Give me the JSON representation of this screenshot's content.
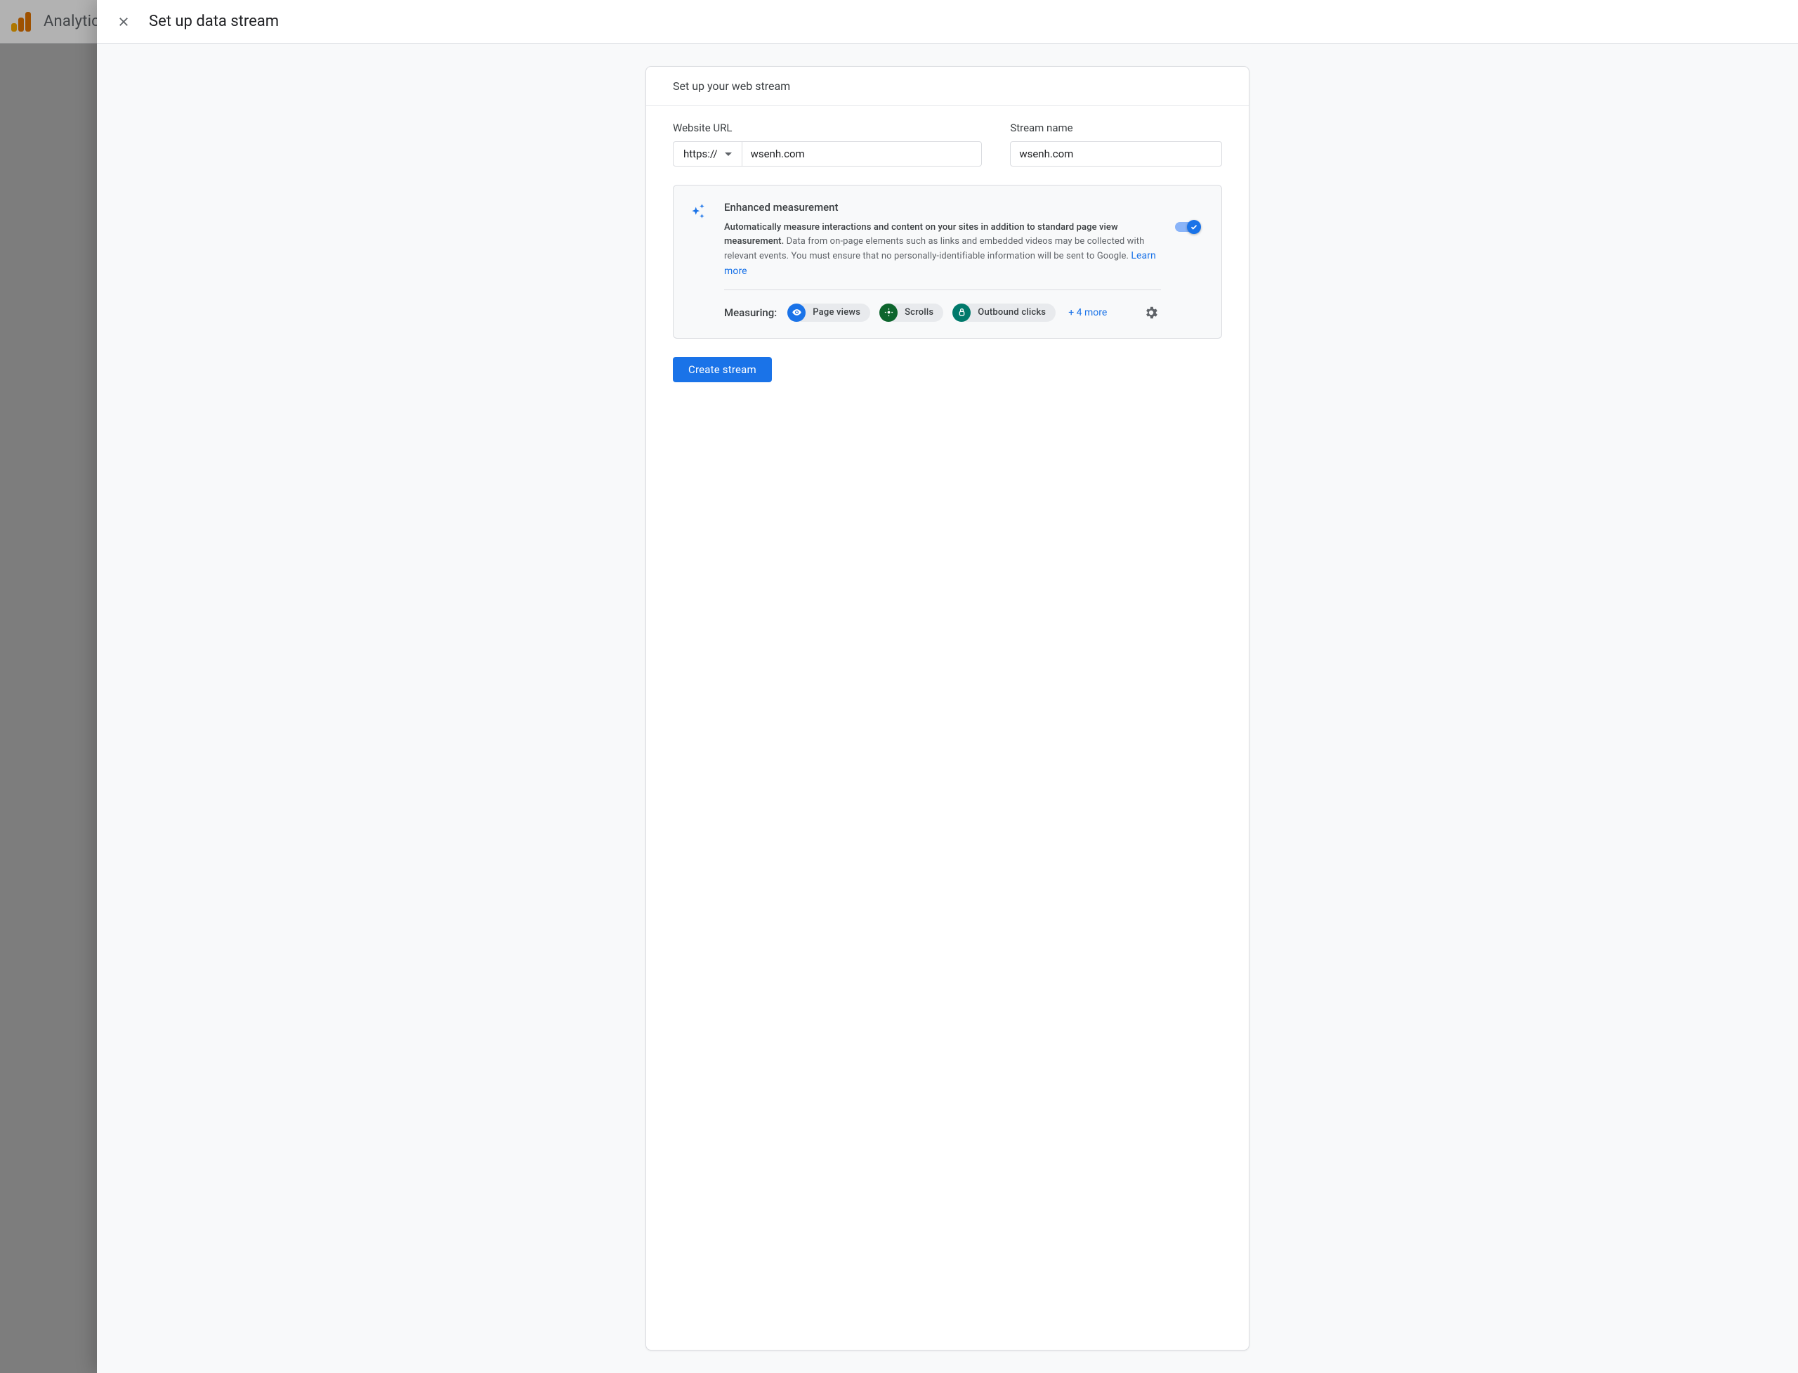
{
  "background": {
    "product_name": "Analytics"
  },
  "panel": {
    "title": "Set up data stream"
  },
  "card": {
    "header": "Set up your web stream",
    "url_label": "Website URL",
    "protocol": "https://",
    "url_value": "wsenh.com",
    "stream_label": "Stream name",
    "stream_value": "wsenh.com"
  },
  "enhanced": {
    "title": "Enhanced measurement",
    "desc_line1": "Automatically measure interactions and content on your sites in addition to standard page view measurement.",
    "desc_line2": "Data from on-page elements such as links and embedded videos may be collected with relevant events. You must ensure that no personally-identifiable information will be sent to Google.",
    "learn_more": "Learn more",
    "toggle_on": true,
    "measuring_label": "Measuring:",
    "chips": {
      "page_views": "Page views",
      "scrolls": "Scrolls",
      "outbound": "Outbound clicks"
    },
    "more": "+ 4 more"
  },
  "actions": {
    "create": "Create stream"
  }
}
